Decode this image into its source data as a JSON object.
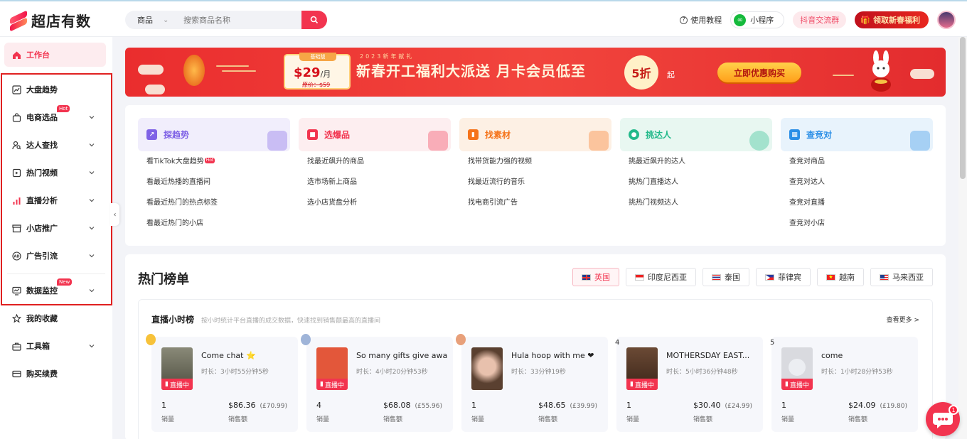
{
  "app": {
    "name": "超店有数"
  },
  "search": {
    "category": "商品",
    "placeholder": "搜索商品名称"
  },
  "topbar": {
    "help": "使用教程",
    "mini_program": "小程序",
    "douyin": "抖音交流群",
    "promo": "领取新春福利"
  },
  "sidebar": {
    "items": [
      {
        "label": "工作台",
        "icon": "home-icon",
        "active": true
      },
      {
        "label": "大盘趋势",
        "icon": "trend-chart-icon"
      },
      {
        "label": "电商选品",
        "icon": "shopping-bag-icon",
        "badge": "Hot"
      },
      {
        "label": "达人查找",
        "icon": "user-search-icon"
      },
      {
        "label": "热门视频",
        "icon": "video-icon"
      },
      {
        "label": "直播分析",
        "icon": "bar-chart-icon"
      },
      {
        "label": "小店推广",
        "icon": "shop-icon"
      },
      {
        "label": "广告引流",
        "icon": "ad-icon"
      },
      {
        "label": "数据监控",
        "icon": "monitor-icon",
        "badge": "New"
      },
      {
        "label": "我的收藏",
        "icon": "star-icon"
      },
      {
        "label": "工具箱",
        "icon": "toolbox-icon"
      },
      {
        "label": "购买续费",
        "icon": "card-icon"
      }
    ]
  },
  "banner": {
    "badge": "基础版",
    "price": "$29",
    "unit": "/月",
    "original": "原价：$59",
    "subtitle": "2023新年献礼",
    "headline": "新春开工福利大派送 月卡会员低至",
    "discount": "5折",
    "discount_suffix": "起",
    "cta": "立即优惠购买"
  },
  "categories": [
    {
      "title": "探趋势",
      "color": "#7f62e6",
      "bg": "#f1eefc",
      "links": [
        "看TikTok大盘趋势",
        "看最近热播的直播间",
        "看最近热门的热点标签",
        "看最近热门的小店"
      ],
      "tag": "Hot"
    },
    {
      "title": "选爆品",
      "color": "#f2344f",
      "bg": "#fdeef0",
      "links": [
        "找最近飙升的商品",
        "选市场新上商品",
        "选小店货盘分析"
      ]
    },
    {
      "title": "找素材",
      "color": "#f5731a",
      "bg": "#fdf0e4",
      "links": [
        "找带货能力强的视频",
        "找最近流行的音乐",
        "找电商引流广告"
      ]
    },
    {
      "title": "挑达人",
      "color": "#22b98a",
      "bg": "#e8f7f1",
      "links": [
        "挑最近飙升的达人",
        "挑热门直播达人",
        "挑热门视频达人"
      ]
    },
    {
      "title": "查竞对",
      "color": "#2a8ee6",
      "bg": "#e8f3fc",
      "links": [
        "查竞对商品",
        "查竞对达人",
        "查竞对直播",
        "查竞对小店"
      ]
    }
  ],
  "hot": {
    "title": "热门榜单",
    "countries": [
      "英国",
      "印度尼西亚",
      "泰国",
      "菲律宾",
      "越南",
      "马来西亚"
    ],
    "card_title": "直播小时榜",
    "card_sub": "按小时统计平台直播的成交数据，快速找到销售额最高的直播间",
    "more": "查看更多 >",
    "live_label": "直播中",
    "sales_label": "销量",
    "revenue_label": "销售额",
    "items": [
      {
        "rank": "1",
        "name": "Come chat ⭐",
        "duration": "时长：3小时55分钟5秒",
        "sales": "1",
        "revenue": "$86.36",
        "revenue_local": "(£70.99)",
        "thumb": "#6a6a5a"
      },
      {
        "rank": "2",
        "name": "So many gifts give away!!",
        "duration": "时长：4小时20分钟53秒",
        "sales": "4",
        "revenue": "$68.08",
        "revenue_local": "(£55.96)",
        "thumb": "#e3573a"
      },
      {
        "rank": "3",
        "name": "Hula hoop with me ❤",
        "duration": "时长：33分钟19秒",
        "sales": "1",
        "revenue": "$48.65",
        "revenue_local": "(£39.99)",
        "thumb": "#c9a08a"
      },
      {
        "rank": "4",
        "name": "MOTHERSDAY EAST...",
        "duration": "时长：5小时36分钟48秒",
        "sales": "1",
        "revenue": "$30.40",
        "revenue_local": "(£24.99)",
        "thumb": "#5a3a2a"
      },
      {
        "rank": "5",
        "name": "come",
        "duration": "时长：1小时28分钟53秒",
        "sales": "1",
        "revenue": "$24.09",
        "revenue_local": "(£19.80)",
        "thumb": "#d9dadf"
      }
    ]
  },
  "chat": {
    "badge": "1"
  }
}
